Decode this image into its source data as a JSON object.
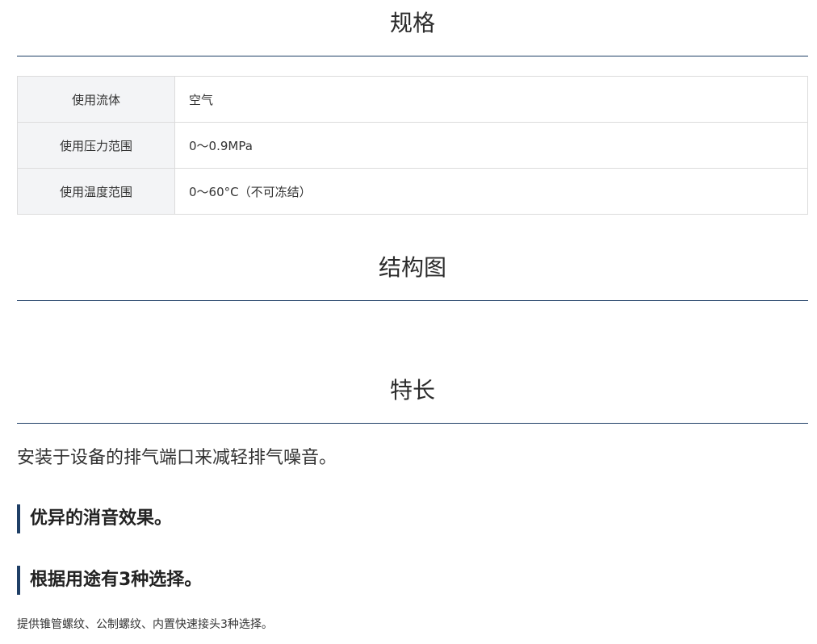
{
  "specs": {
    "title": "规格",
    "rows": [
      {
        "label": "使用流体",
        "value": "空气"
      },
      {
        "label": "使用压力范围",
        "value": "0～0.9MPa"
      },
      {
        "label": "使用温度范围",
        "value": "0～60°C（不可冻结）"
      }
    ]
  },
  "structure": {
    "title": "结构图"
  },
  "features": {
    "title": "特长",
    "intro": "安装于设备的排气端口来减轻排气噪音。",
    "items": [
      {
        "heading": "优异的消音效果。"
      },
      {
        "heading": "根据用途有3种选择。",
        "note": "提供锥管螺纹、公制螺纹、内置快速接头3种选择。"
      }
    ]
  }
}
